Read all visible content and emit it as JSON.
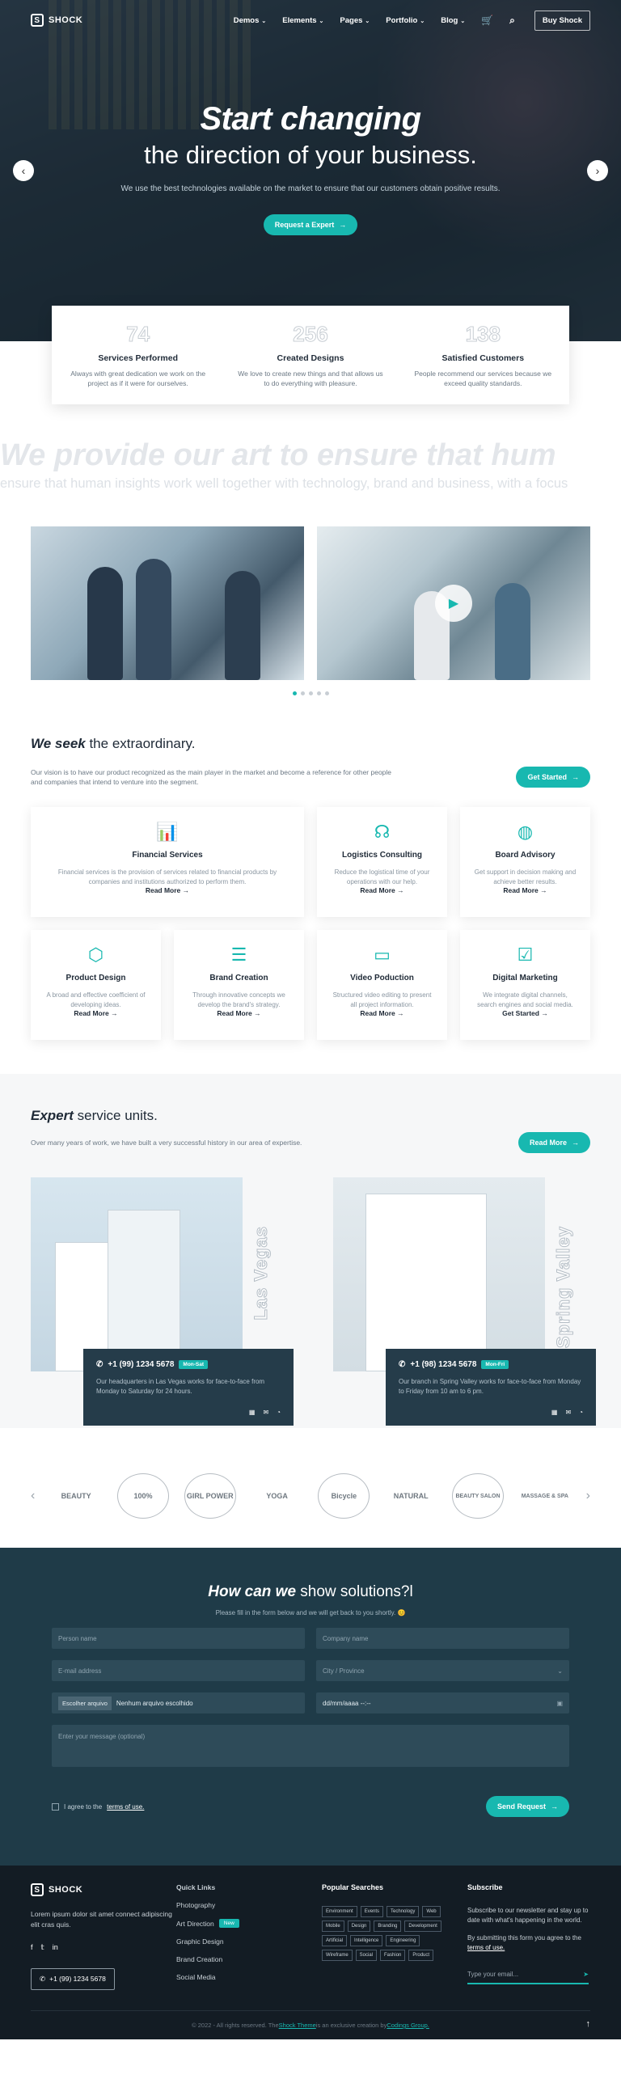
{
  "nav": {
    "brand": "SHOCK",
    "items": [
      "Demos",
      "Elements",
      "Pages",
      "Portfolio",
      "Blog"
    ],
    "buy_label": "Buy Shock"
  },
  "hero": {
    "title": "Start changing",
    "subtitle": "the direction of your business.",
    "text": "We use the best technologies available on the market to ensure that our customers obtain positive results.",
    "cta": "Request a Expert",
    "prev_icon": "chevron-left-icon",
    "next_icon": "chevron-right-icon"
  },
  "stats": [
    {
      "number": "74",
      "label": "Services Performed",
      "text": "Always with great dedication we work on the project as if it were for ourselves."
    },
    {
      "number": "256",
      "label": "Created Designs",
      "text": "We love to create new things and that allows us to do everything with pleasure."
    },
    {
      "number": "138",
      "label": "Satisfied Customers",
      "text": "People recommend our services because we exceed quality standards."
    }
  ],
  "slogan": {
    "big": "We provide our art to ensure that hum",
    "small": "ensure that human insights work well together with technology, brand and business, with a focus"
  },
  "seek": {
    "title_bold": "We seek",
    "title_light": " the extraordinary.",
    "desc": "Our vision is to have our product recognized as the main player in the market and become a reference for other people and companies that intend to venture into the segment.",
    "cta": "Get Started"
  },
  "services": [
    {
      "icon": "bar-chart-icon",
      "title": "Financial Services",
      "desc": "Financial services is the provision of services related to financial products by companies and institutions authorized to perform them.",
      "link": "Read More"
    },
    {
      "icon": "support-icon",
      "title": "Logistics Consulting",
      "desc": "Reduce the logistical time of your operations with our help.",
      "link": "Read More"
    },
    {
      "icon": "globe-icon",
      "title": "Board Advisory",
      "desc": "Get support in decision making and achieve better results.",
      "link": "Read More"
    },
    {
      "icon": "box-icon",
      "title": "Product Design",
      "desc": "A broad and effective coefficient of developing ideas.",
      "link": "Read More"
    },
    {
      "icon": "layers-icon",
      "title": "Brand Creation",
      "desc": "Through innovative concepts we develop the brand's strategy.",
      "link": "Read More"
    },
    {
      "icon": "video-icon",
      "title": "Video Poduction",
      "desc": "Structured video editing to present all project information.",
      "link": "Read More"
    },
    {
      "icon": "clipboard-icon",
      "title": "Digital Marketing",
      "desc": "We integrate digital channels, search engines and social media.",
      "link": "Get Started"
    }
  ],
  "units": {
    "title_bold": "Expert",
    "title_light": " service units.",
    "desc": "Over many years of work, we have built a very successful history in our area of expertise.",
    "cta": "Read More",
    "locations": [
      {
        "city": "Las Vegas",
        "phone": "+1 (99) 1234 5678",
        "hours": "Mon-Sat",
        "text": "Our headquarters in Las Vegas works for face-to-face from Monday to Saturday for 24 hours."
      },
      {
        "city": "Spring Valley",
        "phone": "+1 (98) 1234 5678",
        "hours": "Mon-Fri",
        "text": "Our branch in Spring Valley works for face-to-face from Monday to Friday from 10 am to 6 pm."
      }
    ]
  },
  "brands": [
    "BEAUTY",
    "100%",
    "GIRL POWER",
    "YOGA",
    "Bicycle",
    "NATURAL",
    "BEAUTY SALON",
    "MASSAGE & SPA"
  ],
  "contact": {
    "title_bold": "How can we",
    "title_light": " show solutions?l",
    "sub": "Please fill in the form below and we will get back to you shortly. 😊",
    "person_name": "Person name",
    "company_name": "Company name",
    "email": "E-mail address",
    "city": "City / Province",
    "file_button": "Escolher arquivo",
    "file_value": "Nenhum arquivo escolhido",
    "date": "dd/mm/aaaa --:--",
    "message": "Enter your message (optional)",
    "agree_prefix": "I agree to the ",
    "agree_link": "terms of use.",
    "submit": "Send Request"
  },
  "footer": {
    "brand": "SHOCK",
    "about": "Lorem ipsum dolor sit amet connect adipiscing elit cras quis.",
    "phone": "+1 (99) 1234 5678",
    "quick_title": "Quick Links",
    "quick": [
      "Photography",
      "Art Direction",
      "Graphic Design",
      "Brand Creation",
      "Social Media"
    ],
    "new_badge": "New",
    "popular_title": "Popular Searches",
    "popular": [
      "Environment",
      "Events",
      "Technology",
      "Web",
      "Mobile",
      "Design",
      "Branding",
      "Development",
      "Artificial",
      "Intelligence",
      "Engineering",
      "Wireframe",
      "Social",
      "Fashion",
      "Product"
    ],
    "subscribe_title": "Subscribe",
    "subscribe_text": "Subscribe to our newsletter and stay up to date with what's happening in the world.",
    "subscribe_terms_prefix": "By submitting this form you agree to the ",
    "subscribe_terms_link": "terms of use.",
    "email_placeholder": "Type your email...",
    "copy_prefix": "© 2022 - All rights reserved. The ",
    "copy_theme": "Shock Theme",
    "copy_mid": " is an exclusive creation by ",
    "copy_author": "Codings Group."
  }
}
